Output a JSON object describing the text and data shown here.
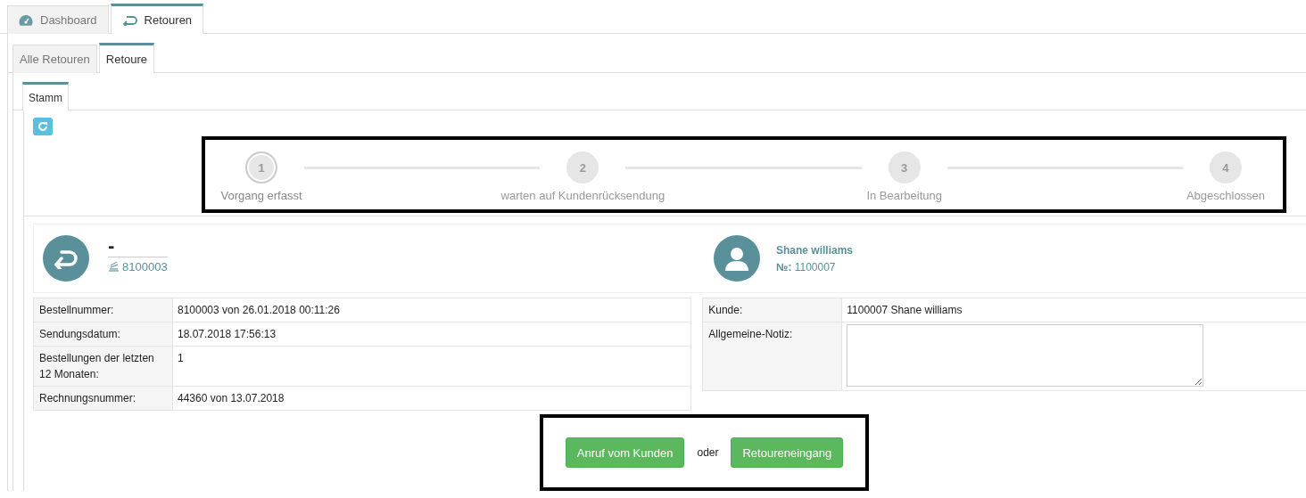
{
  "main_tabs": [
    {
      "kind": "dashboard",
      "label": "Dashboard",
      "selected": false
    },
    {
      "kind": "return",
      "label": "Retouren",
      "selected": true
    }
  ],
  "sub_tabs": [
    {
      "label": "Alle Retouren",
      "selected": false
    },
    {
      "label": "Retoure",
      "selected": true
    }
  ],
  "section_tabs": [
    {
      "label": "Stamm",
      "selected": true
    }
  ],
  "steps": [
    {
      "number": "1",
      "label": "Vorgang erfasst",
      "selected": true
    },
    {
      "number": "2",
      "label": "warten auf Kundenrücksendung",
      "selected": false
    },
    {
      "number": "3",
      "label": "In Bearbeitung",
      "selected": false
    },
    {
      "number": "4",
      "label": "Abgeschlossen",
      "selected": false
    }
  ],
  "order": {
    "title": "-",
    "number": "8100003"
  },
  "customer": {
    "name": "Shane williams",
    "number_label": "№:",
    "number": "1100007"
  },
  "order_table": [
    {
      "label": "Bestellnummer:",
      "value": "8100003 von 26.01.2018 00:11:26"
    },
    {
      "label": "Sendungsdatum:",
      "value": "18.07.2018 17:56:13"
    },
    {
      "label": "Bestellungen der letzten 12 Monaten:",
      "value": "1"
    },
    {
      "label": "Rechnungsnummer:",
      "value": "44360 von 13.07.2018"
    }
  ],
  "customer_table": [
    {
      "kind": "text",
      "label": "Kunde:",
      "value": "1100007 Shane williams"
    },
    {
      "kind": "textarea",
      "label": "Allgemeine-Notiz:"
    }
  ],
  "actions": [
    {
      "kind": "button",
      "label": "Anruf vom Kunden"
    },
    {
      "kind": "text",
      "label": "oder"
    },
    {
      "kind": "button",
      "label": "Retoureneingang"
    }
  ]
}
